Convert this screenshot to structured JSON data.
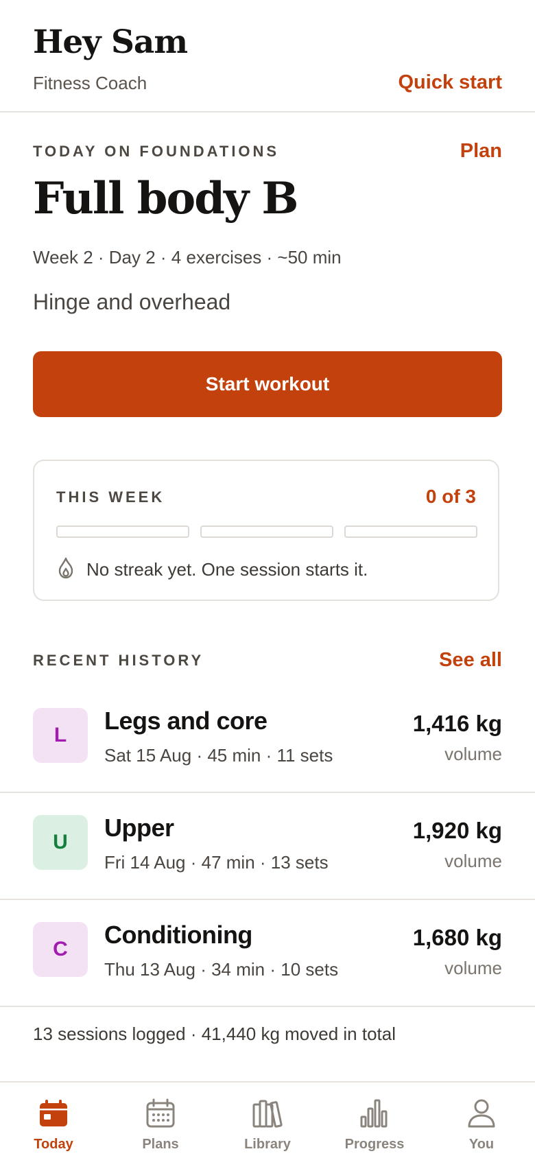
{
  "header": {
    "greeting": "Hey Sam",
    "app_name": "Fitness Coach",
    "quick_start_label": "Quick start"
  },
  "today": {
    "eyebrow": "TODAY ON FOUNDATIONS",
    "plan_label": "Plan",
    "workout_title": "Full body B",
    "meta": "Week 2 · Day 2 · 4 exercises · ~50 min",
    "focus": "Hinge and overhead",
    "start_label": "Start workout"
  },
  "this_week": {
    "eyebrow": "THIS WEEK",
    "count_label": "0 of 3",
    "completed": 0,
    "target": 3,
    "streak_icon": "flame-outline-icon",
    "streak_text": "No streak yet. One session starts it."
  },
  "history": {
    "eyebrow": "RECENT HISTORY",
    "see_all_label": "See all",
    "items": [
      {
        "initial": "L",
        "title": "Legs and core",
        "meta": "Sat 15 Aug · 45 min · 11 sets",
        "volume": "1,416 kg",
        "volume_label": "volume",
        "badge_bg": "#f3e1f4",
        "badge_fg": "#a21caf"
      },
      {
        "initial": "U",
        "title": "Upper",
        "meta": "Fri 14 Aug · 47 min · 13 sets",
        "volume": "1,920 kg",
        "volume_label": "volume",
        "badge_bg": "#dcefe3",
        "badge_fg": "#15803d"
      },
      {
        "initial": "C",
        "title": "Conditioning",
        "meta": "Thu 13 Aug · 34 min · 10 sets",
        "volume": "1,680 kg",
        "volume_label": "volume",
        "badge_bg": "#f3e1f4",
        "badge_fg": "#a21caf"
      }
    ],
    "summary": "13 sessions logged · 41,440 kg moved in total"
  },
  "nav": {
    "items": [
      {
        "label": "Today",
        "icon": "calendar-filled-icon",
        "active": true
      },
      {
        "label": "Plans",
        "icon": "calendar-grid-icon",
        "active": false
      },
      {
        "label": "Library",
        "icon": "books-icon",
        "active": false
      },
      {
        "label": "Progress",
        "icon": "bar-chart-icon",
        "active": false
      },
      {
        "label": "You",
        "icon": "person-icon",
        "active": false
      }
    ]
  },
  "colors": {
    "accent": "#c2410c",
    "text": "#161412",
    "muted": "#4a4540",
    "nav_inactive": "#8a847d"
  }
}
